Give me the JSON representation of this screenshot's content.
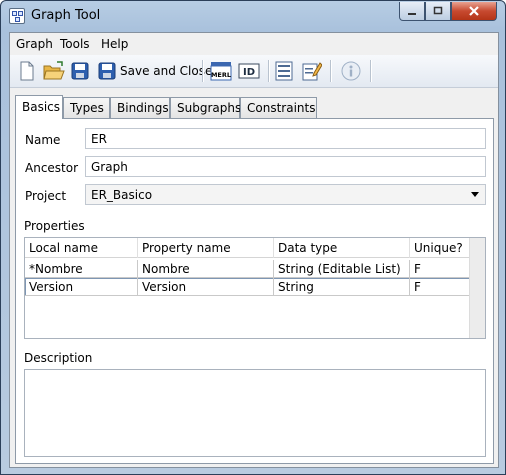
{
  "window": {
    "title": "Graph Tool"
  },
  "menu": {
    "items": [
      "Graph",
      "Tools",
      "Help"
    ]
  },
  "toolbar": {
    "new_icon": "new-document-icon",
    "open_icon": "open-folder-icon",
    "save_icon": "save-disk-icon",
    "save_close_label": "Save and Close",
    "merl_label": "MERL",
    "id_label": "ID",
    "info_icon": "info-icon"
  },
  "tabs": [
    "Basics",
    "Types",
    "Bindings",
    "Subgraphs",
    "Constraints"
  ],
  "form": {
    "name_label": "Name",
    "name_value": "ER",
    "ancestor_label": "Ancestor",
    "ancestor_value": "Graph",
    "project_label": "Project",
    "project_value": "ER_Basico"
  },
  "properties": {
    "label": "Properties",
    "columns": [
      "Local name",
      "Property name",
      "Data type",
      "Unique?"
    ],
    "rows": [
      [
        "*Nombre",
        "Nombre",
        "String (Editable List)",
        "F"
      ],
      [
        "Version",
        "Version",
        "String",
        "F"
      ]
    ]
  },
  "description": {
    "label": "Description",
    "value": ""
  }
}
